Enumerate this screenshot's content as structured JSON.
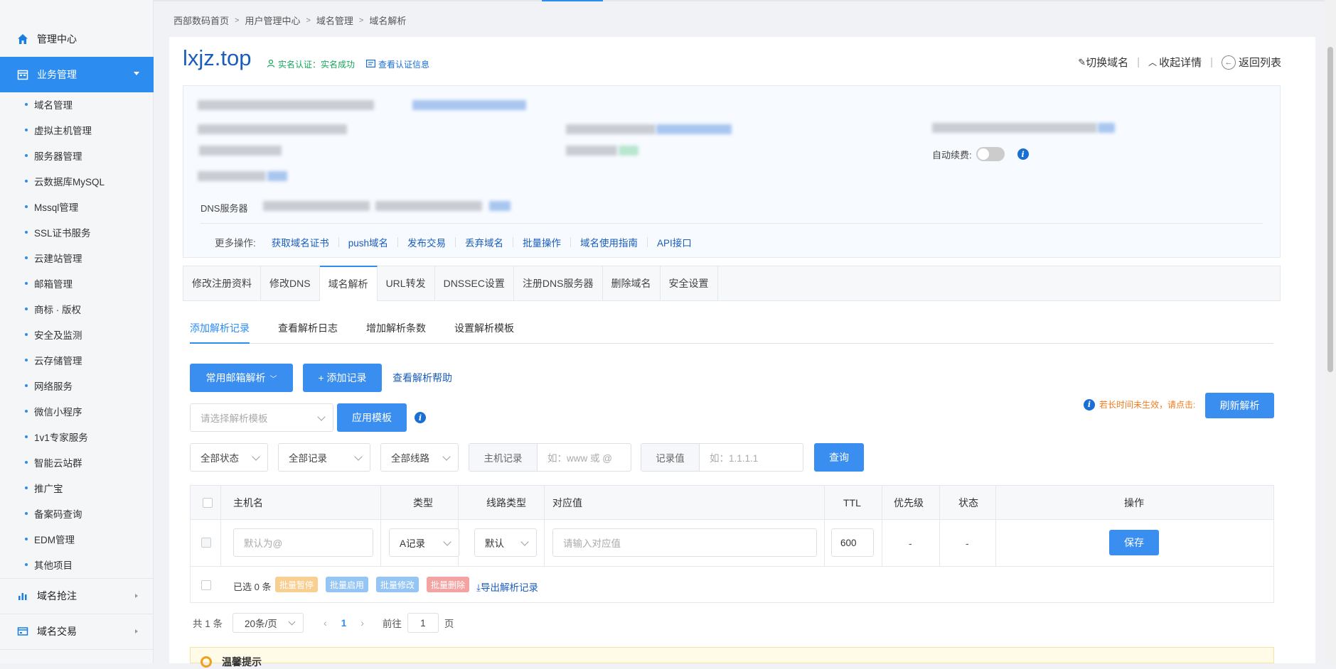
{
  "sidebar": {
    "header": "管理中心",
    "active_group": "业务管理",
    "items": [
      "域名管理",
      "虚拟主机管理",
      "服务器管理",
      "云数据库MySQL",
      "Mssql管理",
      "SSL证书服务",
      "云建站管理",
      "邮箱管理",
      "商标 · 版权",
      "安全及监测",
      "云存储管理",
      "网络服务",
      "微信小程序",
      "1v1专家服务",
      "智能云站群",
      "推广宝",
      "备案码查询",
      "EDM管理",
      "其他项目"
    ],
    "group2": "域名抢注",
    "group3": "域名交易"
  },
  "breadcrumb": [
    "西部数码首页",
    "用户管理中心",
    "域名管理",
    "域名解析"
  ],
  "domain": {
    "name": "lxjz.top",
    "verify_status": "实名认证：实名成功",
    "verify_link": "查看认证信息"
  },
  "top_actions": {
    "switch": "切换域名",
    "collapse": "收起详情",
    "back": "返回列表"
  },
  "info": {
    "dns_label": "DNS服务器",
    "auto_renew_label": "自动续费:",
    "more_ops_label": "更多操作:",
    "more_ops": [
      "获取域名证书",
      "push域名",
      "发布交易",
      "丢弃域名",
      "批量操作",
      "域名使用指南",
      "API接口"
    ]
  },
  "tabs": [
    "修改注册资料",
    "修改DNS",
    "域名解析",
    "URL转发",
    "DNSSEC设置",
    "注册DNS服务器",
    "删除域名",
    "安全设置"
  ],
  "subtabs": [
    "添加解析记录",
    "查看解析日志",
    "增加解析条数",
    "设置解析模板"
  ],
  "toolbar": {
    "mail_btn": "常用邮箱解析",
    "add_btn": "+ 添加记录",
    "help_link": "查看解析帮助",
    "template_placeholder": "请选择解析模板",
    "apply_btn": "应用模板",
    "warn_tip": "若长时间未生效，请点击:",
    "refresh_btn": "刷新解析"
  },
  "filters": {
    "status": "全部状态",
    "record": "全部记录",
    "line": "全部线路",
    "host_label": "主机记录",
    "host_placeholder": "如：www 或 @",
    "value_label": "记录值",
    "value_placeholder": "如：1.1.1.1",
    "query_btn": "查询"
  },
  "table": {
    "headers": [
      "主机名",
      "类型",
      "线路类型",
      "对应值",
      "TTL",
      "优先级",
      "状态",
      "操作"
    ],
    "row": {
      "host_placeholder": "默认为@",
      "type": "A记录",
      "line": "默认",
      "value_placeholder": "请输入对应值",
      "ttl": "600",
      "priority": "-",
      "status": "-",
      "save": "保存"
    },
    "footer": {
      "selected": "已选 0 条",
      "batch_pause": "批量暂停",
      "batch_enable": "批量启用",
      "batch_edit": "批量修改",
      "batch_delete": "批量删除",
      "export": "导出解析记录"
    }
  },
  "pager": {
    "total": "共 1 条",
    "size": "20条/页",
    "current": "1",
    "goto_label": "前往",
    "goto_value": "1",
    "page_suffix": "页"
  },
  "tip": {
    "title": "温馨提示"
  }
}
